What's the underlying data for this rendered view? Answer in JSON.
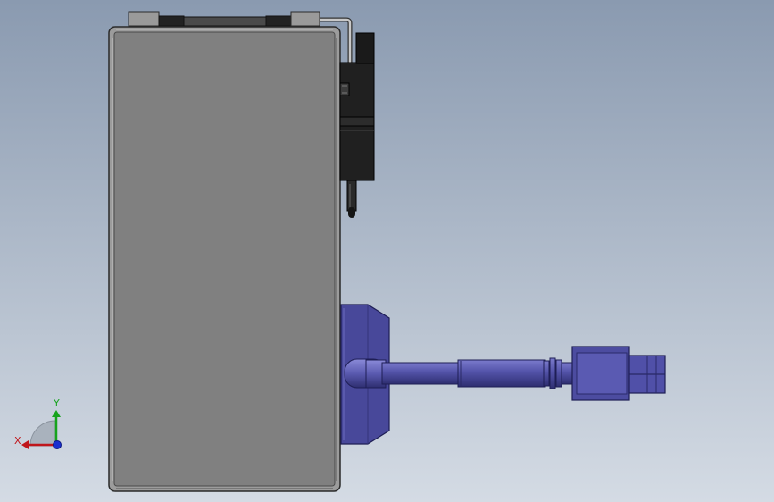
{
  "viewport": {
    "background_top": "#8a9ab0",
    "background_bottom": "#d4dbe4"
  },
  "model": {
    "housing_color": "#7f7f7f",
    "housing_edge": "#3a3a3a",
    "bracket_color": "#1e1e1e",
    "connector_color": "#4a4a9a",
    "connector_dark": "#2e2e6e",
    "cable_color": "#5252a8"
  },
  "triad": {
    "x_label": "X",
    "y_label": "Y",
    "x_color": "#c0161b",
    "y_color": "#17a31d",
    "z_color": "#1a2fd0"
  }
}
